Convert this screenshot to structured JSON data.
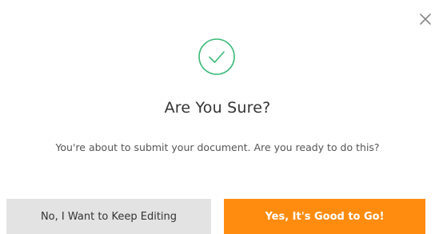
{
  "dialog": {
    "title": "Are You Sure?",
    "message": "You're about to submit your document. Are you ready to do this?",
    "cancel_label": "No, I Want to Keep Editing",
    "confirm_label": "Yes, It's Good to Go!",
    "icons": {
      "close": "close-icon",
      "status": "check-circle-icon"
    },
    "colors": {
      "success": "#3cbb7a",
      "confirm_bg": "#ff8c0f",
      "cancel_bg": "#e3e3e3"
    }
  }
}
